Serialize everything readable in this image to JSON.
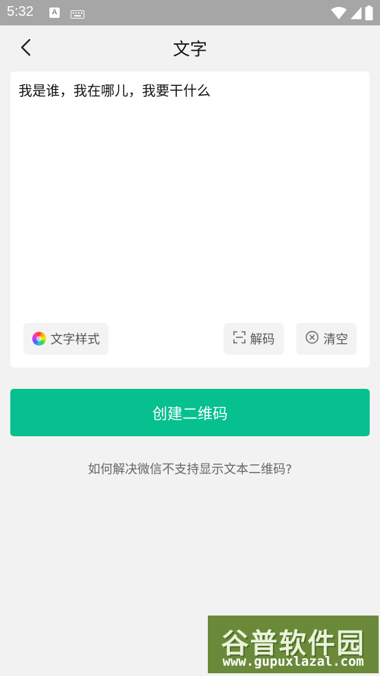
{
  "status_bar": {
    "time": "5:32",
    "a_icon_letter": "A",
    "icons": [
      "a-badge-icon",
      "keyboard-icon",
      "wifi-icon",
      "signal-icon",
      "battery-icon"
    ]
  },
  "header": {
    "title": "文字",
    "back_icon": "chevron-left-icon"
  },
  "editor": {
    "value": "我是谁，我在哪儿，我要干什么"
  },
  "actions": {
    "text_style_label": "文字样式",
    "decode_label": "解码",
    "clear_label": "清空"
  },
  "create_button_label": "创建二维码",
  "help_link": "如何解决微信不支持显示文本二维码?",
  "watermark": {
    "title": "谷普软件园",
    "url": "www.gupuxlazal.com"
  },
  "colors": {
    "accent": "#07c08f",
    "background": "#f2f2f2",
    "status_bar": "#a6a6a6"
  }
}
